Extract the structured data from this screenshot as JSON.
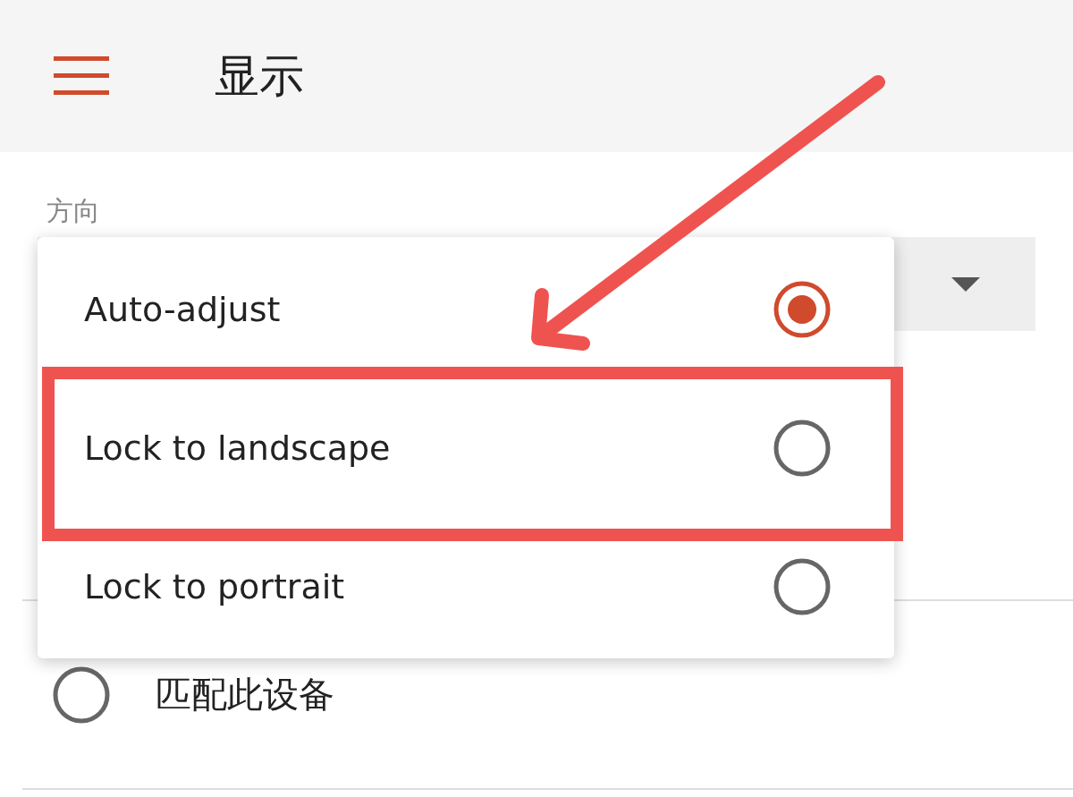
{
  "header": {
    "title": "显示"
  },
  "orientation": {
    "label": "方向",
    "options": [
      {
        "label": "Auto-adjust",
        "selected": true
      },
      {
        "label": "Lock to landscape",
        "selected": false
      },
      {
        "label": "Lock to portrait",
        "selected": false
      }
    ]
  },
  "match_device": {
    "label": "匹配此设备",
    "selected": false
  }
}
